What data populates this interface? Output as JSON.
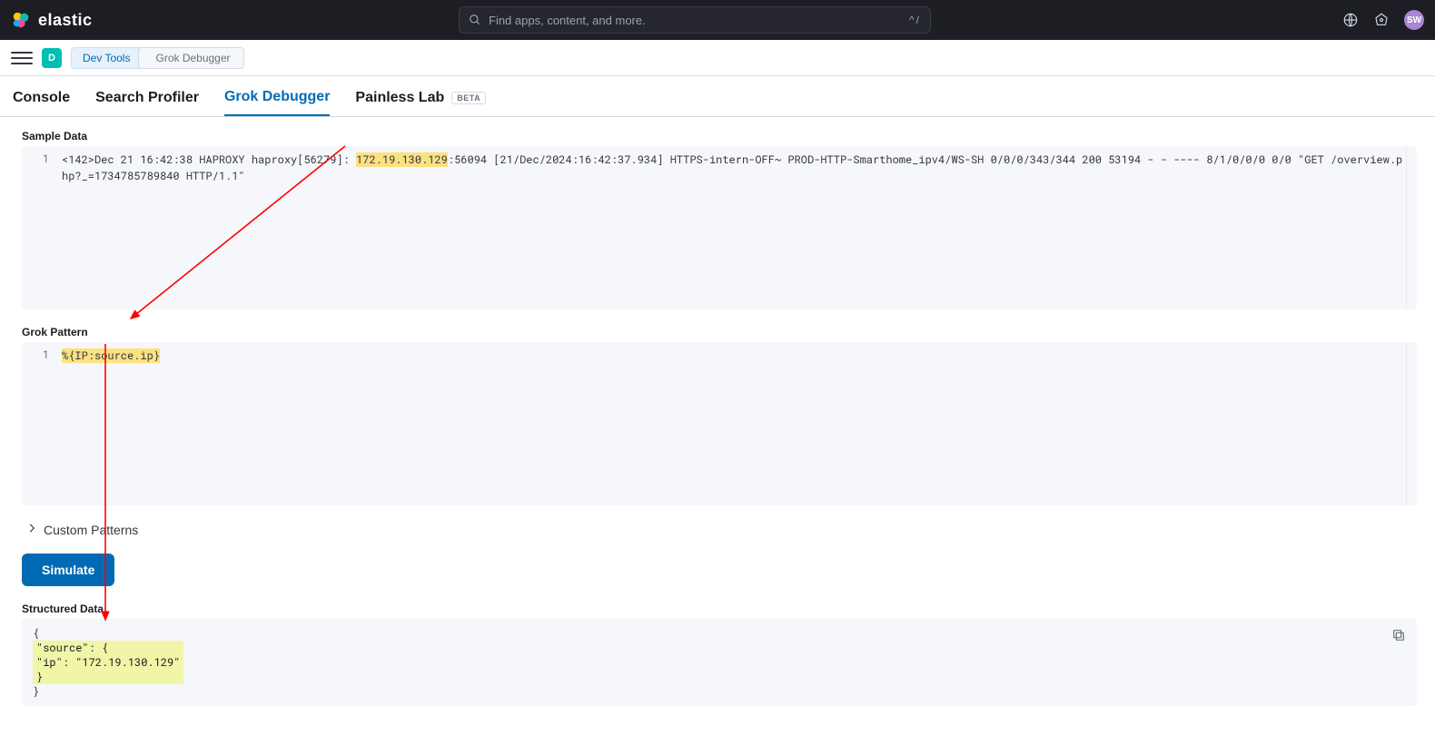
{
  "header": {
    "brand": "elastic",
    "search_placeholder": "Find apps, content, and more.",
    "kbd_hint": "^/",
    "avatar_initials": "SW"
  },
  "nav": {
    "app_chip": "D",
    "crumb1": "Dev Tools",
    "crumb2": "Grok Debugger"
  },
  "tabs": {
    "console": "Console",
    "search_profiler": "Search Profiler",
    "grok_debugger": "Grok Debugger",
    "painless_lab": "Painless Lab",
    "beta": "BETA"
  },
  "labels": {
    "sample_data": "Sample Data",
    "grok_pattern": "Grok Pattern",
    "custom_patterns": "Custom Patterns",
    "simulate": "Simulate",
    "structured_data": "Structured Data"
  },
  "editors": {
    "sample_line_no": "1",
    "sample_pre": "<142>Dec 21 16:42:38 HAPROXY haproxy[56279]: ",
    "sample_ip": "172.19.130.129",
    "sample_post": ":56094 [21/Dec/2024:16:42:37.934] HTTPS-intern-OFF~ PROD-HTTP-Smarthome_ipv4/WS-SH 0/0/0/343/344 200 53194 - - ---- 8/1/0/0/0 0/0 \"GET /overview.php?_=1734785789840 HTTP/1.1\"",
    "pattern_line_no": "1",
    "pattern_text": "%{IP:source.ip}"
  },
  "output": {
    "open_brace": "{",
    "source_key": "  \"source\": {",
    "ip_line": "    \"ip\": \"172.19.130.129\"",
    "close_inner": "  }",
    "close_brace": "}"
  }
}
